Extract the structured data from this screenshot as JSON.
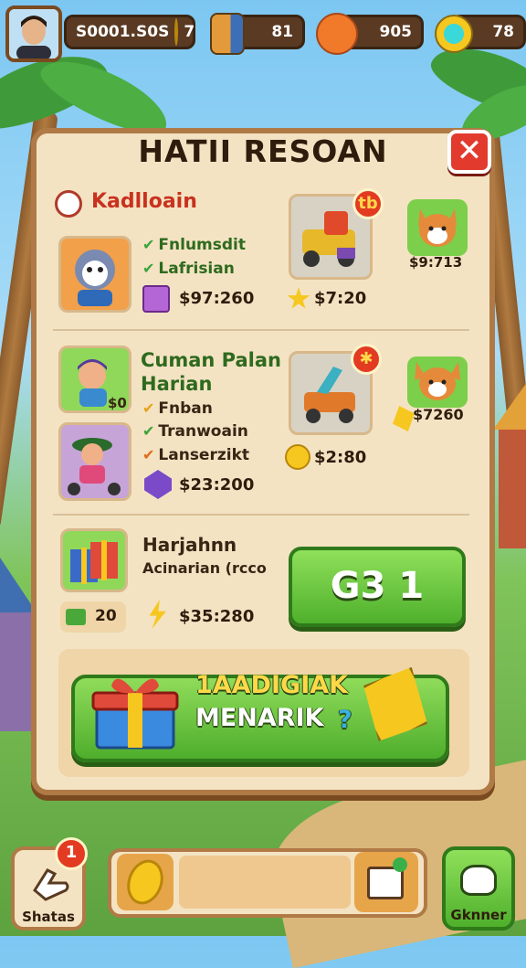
{
  "top_bar": {
    "coins": "S0001.S0S",
    "coin_extra": "7",
    "crates": "81",
    "fruit": "905",
    "gems": "78"
  },
  "panel": {
    "title": "HATII RESOAN",
    "close_label": "✕"
  },
  "section1": {
    "header": "Kadlloain",
    "items": [
      "Fnlumsdit",
      "Lafrisian"
    ],
    "reward_price": "$97:260",
    "car_price": "$7:20",
    "car_badge": "tb",
    "pet_price": "$9:713"
  },
  "section2": {
    "header_line1": "Cuman Palan",
    "header_line2": "Harian",
    "char_count": "$0",
    "items": [
      "Fnban",
      "Tranwoain",
      "Lanserzikt"
    ],
    "reward_price": "$23:200",
    "car_price": "$2:80",
    "car_badge": "✱",
    "pet_price": "$7260"
  },
  "section3": {
    "header": "Harjahnn",
    "subheader": "Acinarian (rcco",
    "cash_amount": "20",
    "price": "$35:280",
    "button_label": "G3 1"
  },
  "banner": {
    "line1": "1AADIGIAK",
    "line2": "MENARIK",
    "mark": "?"
  },
  "bottom_bar": {
    "left_label": "Shatas",
    "left_badge": "1",
    "right_label": "Gknner"
  }
}
